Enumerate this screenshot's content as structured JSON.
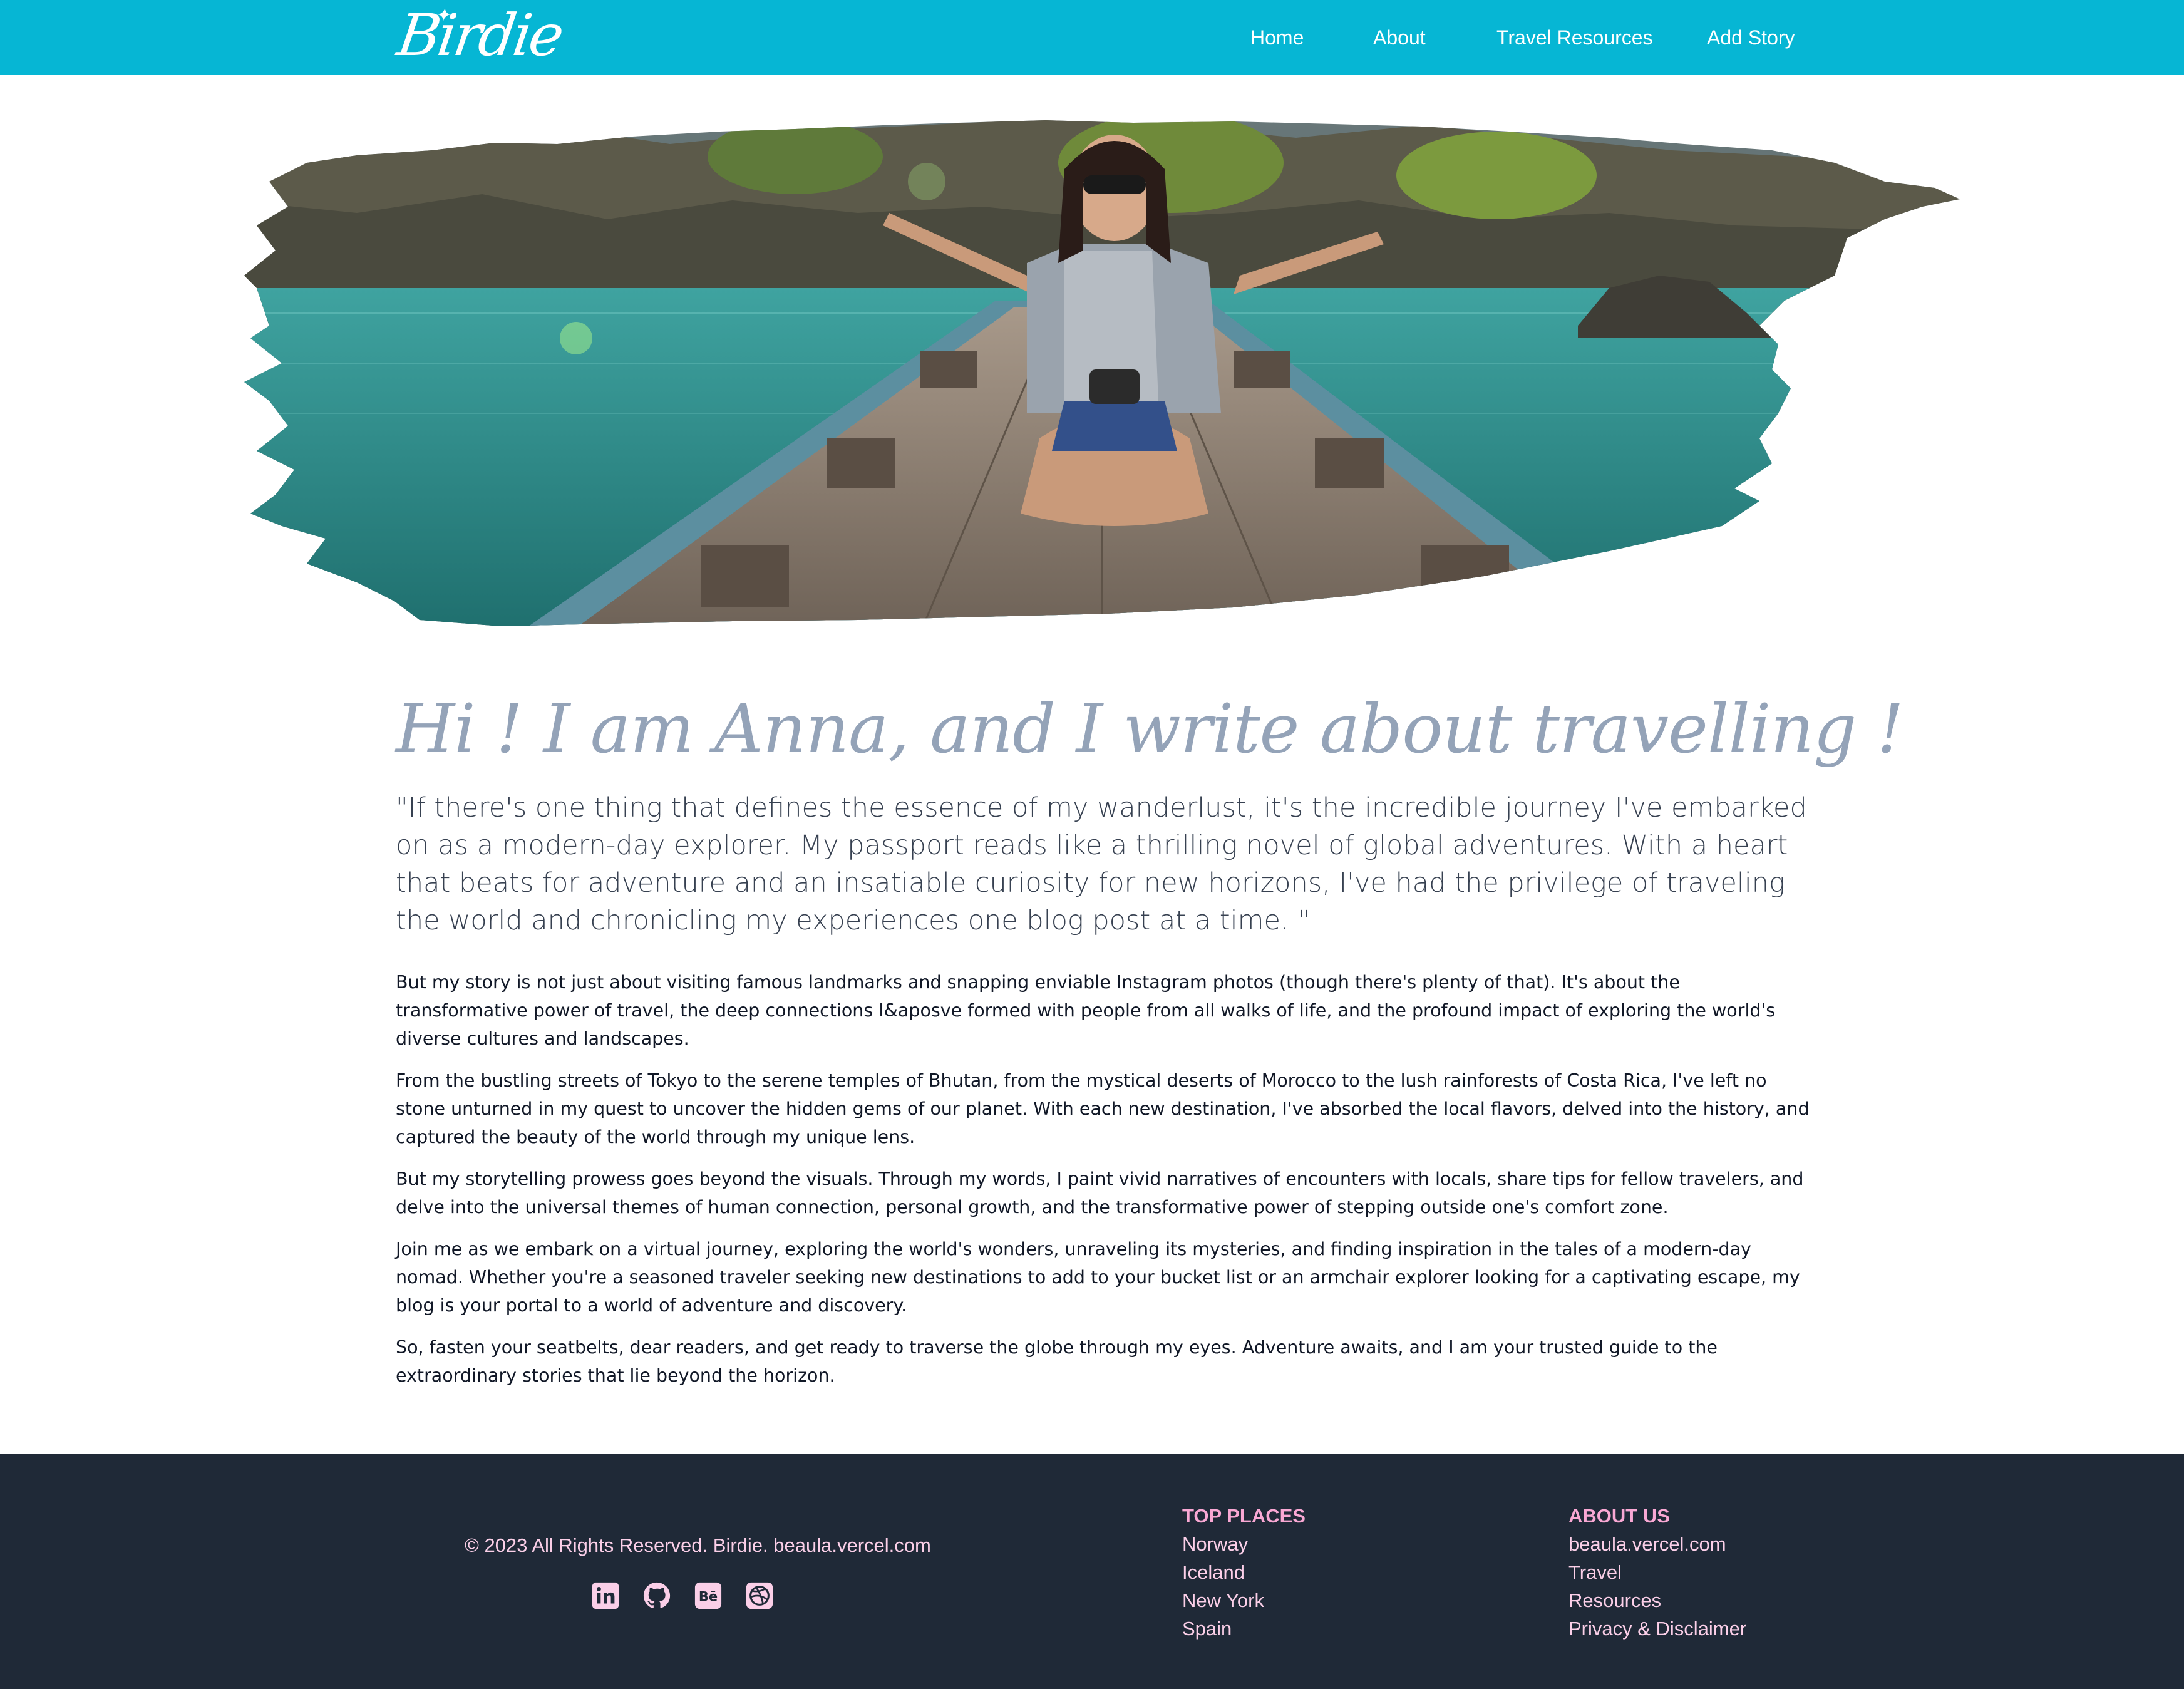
{
  "nav": {
    "brand": "Birdie",
    "links": [
      "Home",
      "About",
      "Travel Resources",
      "Add Story"
    ]
  },
  "hero": {
    "image": "woman-on-boat-photo"
  },
  "about": {
    "title": "Hi ! I am Anna, and I write about travelling !",
    "lead": "\"If there's one thing that defines the essence of my wanderlust, it's the incredible journey I've embarked on as a modern-day explorer. My passport reads like a thrilling novel of global adventures. With a heart that beats for adventure and an insatiable curiosity for new horizons, I've had the privilege of traveling the world and chronicling my experiences one blog post at a time. \"",
    "paragraphs": [
      "But my story is not just about visiting famous landmarks and snapping enviable Instagram photos (though there's plenty of that). It's about the transformative power of travel, the deep connections I&aposve formed with people from all walks of life, and the profound impact of exploring the world's diverse cultures and landscapes.",
      "From the bustling streets of Tokyo to the serene temples of Bhutan, from the mystical deserts of Morocco to the lush rainforests of Costa Rica, I've left no stone unturned in my quest to uncover the hidden gems of our planet. With each new destination, I've absorbed the local flavors, delved into the history, and captured the beauty of the world through my unique lens.",
      "But my storytelling prowess goes beyond the visuals. Through my words, I paint vivid narratives of encounters with locals, share tips for fellow travelers, and delve into the universal themes of human connection, personal growth, and the transformative power of stepping outside one's comfort zone.",
      "Join me as we embark on a virtual journey, exploring the world's wonders, unraveling its mysteries, and finding inspiration in the tales of a modern-day nomad. Whether you're a seasoned traveler seeking new destinations to add to your bucket list or an armchair explorer looking for a captivating escape, my blog is your portal to a world of adventure and discovery.",
      "So, fasten your seatbelts, dear readers, and get ready to traverse the globe through my eyes. Adventure awaits, and I am your trusted guide to the extraordinary stories that lie beyond the horizon."
    ]
  },
  "footer": {
    "copyright": "© 2023 All Rights Reserved. Birdie. beaula.vercel.com",
    "socials": [
      "linkedin-icon",
      "github-icon",
      "behance-icon",
      "dribbble-icon"
    ],
    "top_places": {
      "title": "TOP PLACES",
      "items": [
        "Norway",
        "Iceland",
        "New York",
        "Spain"
      ]
    },
    "about_us": {
      "title": "ABOUT US",
      "items": [
        "beaula.vercel.com",
        "Travel",
        "Resources",
        "Privacy & Disclaimer"
      ]
    }
  },
  "colors": {
    "nav_bg": "#06b6d4",
    "footer_bg": "#1f2937",
    "footer_heading": "#f9a8d4",
    "footer_text": "#fbcfe8",
    "title_color": "#94a3b8"
  }
}
